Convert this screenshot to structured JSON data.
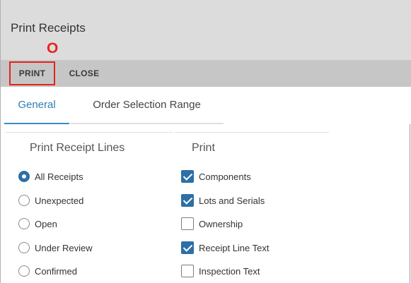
{
  "dialog": {
    "title": "Print Receipts",
    "annotation_marker": "O"
  },
  "toolbar": {
    "print_label": "PRINT",
    "close_label": "CLOSE"
  },
  "tabs": [
    {
      "label": "General",
      "active": true
    },
    {
      "label": "Order Selection Range",
      "active": false
    }
  ],
  "receipt_lines": {
    "heading": "Print Receipt Lines",
    "options": [
      {
        "label": "All Receipts",
        "selected": true
      },
      {
        "label": "Unexpected",
        "selected": false
      },
      {
        "label": "Open",
        "selected": false
      },
      {
        "label": "Under Review",
        "selected": false
      },
      {
        "label": "Confirmed",
        "selected": false
      }
    ]
  },
  "print": {
    "heading": "Print",
    "options": [
      {
        "label": "Components",
        "checked": true
      },
      {
        "label": "Lots and Serials",
        "checked": true
      },
      {
        "label": "Ownership",
        "checked": false
      },
      {
        "label": "Receipt Line Text",
        "checked": true
      },
      {
        "label": "Inspection Text",
        "checked": false
      }
    ]
  },
  "colors": {
    "accent": "#2d6fa6",
    "tab_active": "#2e7fb5",
    "annotation": "#e3241c"
  }
}
